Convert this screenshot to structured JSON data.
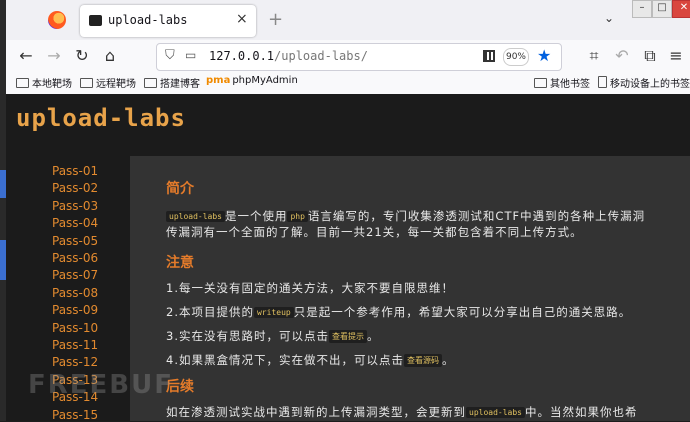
{
  "browser": {
    "tab": {
      "title": "upload-labs",
      "close_icon": "×"
    },
    "new_tab_icon": "+",
    "url": {
      "host": "127.0.0.1",
      "path": "/upload-labs/"
    },
    "zoom": "90%",
    "bookmarks_left": [
      "本地靶场",
      "远程靶场",
      "搭建博客",
      "phpMyAdmin"
    ],
    "bookmarks_right": [
      "其他书签",
      "移动设备上的书签"
    ]
  },
  "page": {
    "logo": "upload-labs",
    "pass_items": [
      "Pass-01",
      "Pass-02",
      "Pass-03",
      "Pass-04",
      "Pass-05",
      "Pass-06",
      "Pass-07",
      "Pass-08",
      "Pass-09",
      "Pass-10",
      "Pass-11",
      "Pass-12",
      "Pass-13",
      "Pass-14",
      "Pass-15"
    ],
    "intro": {
      "title": "简介",
      "code": "upload-labs",
      "line1_rest": "是一个使用",
      "code2": "php",
      "line1_end": "语言编写的，专门收集渗透测试和CTF中遇到的各种上传漏洞",
      "line2": "传漏洞有一个全面的了解。目前一共21关，每一关都包含着不同上传方式。"
    },
    "notes": {
      "title": "注意",
      "n1": "1.每一关没有固定的通关方法，大家不要自限思维！",
      "n2_a": "2.本项目提供的",
      "n2_code": "writeup",
      "n2_b": "只是起一个参考作用，希望大家可以分享出自己的通关思路。",
      "n3_a": "3.实在没有思路时，可以点击",
      "n3_code": "查看提示",
      "n3_b": "。",
      "n4_a": "4.如果黑盒情况下，实在做不出，可以点击",
      "n4_code": "查看源码",
      "n4_b": "。"
    },
    "after": {
      "title": "后续",
      "line_a": "如在渗透测试实战中遇到新的上传漏洞类型，会更新到",
      "line_code": "upload-labs",
      "line_b": "中。当然如果你也希"
    },
    "watermark": "FREEBUF"
  }
}
